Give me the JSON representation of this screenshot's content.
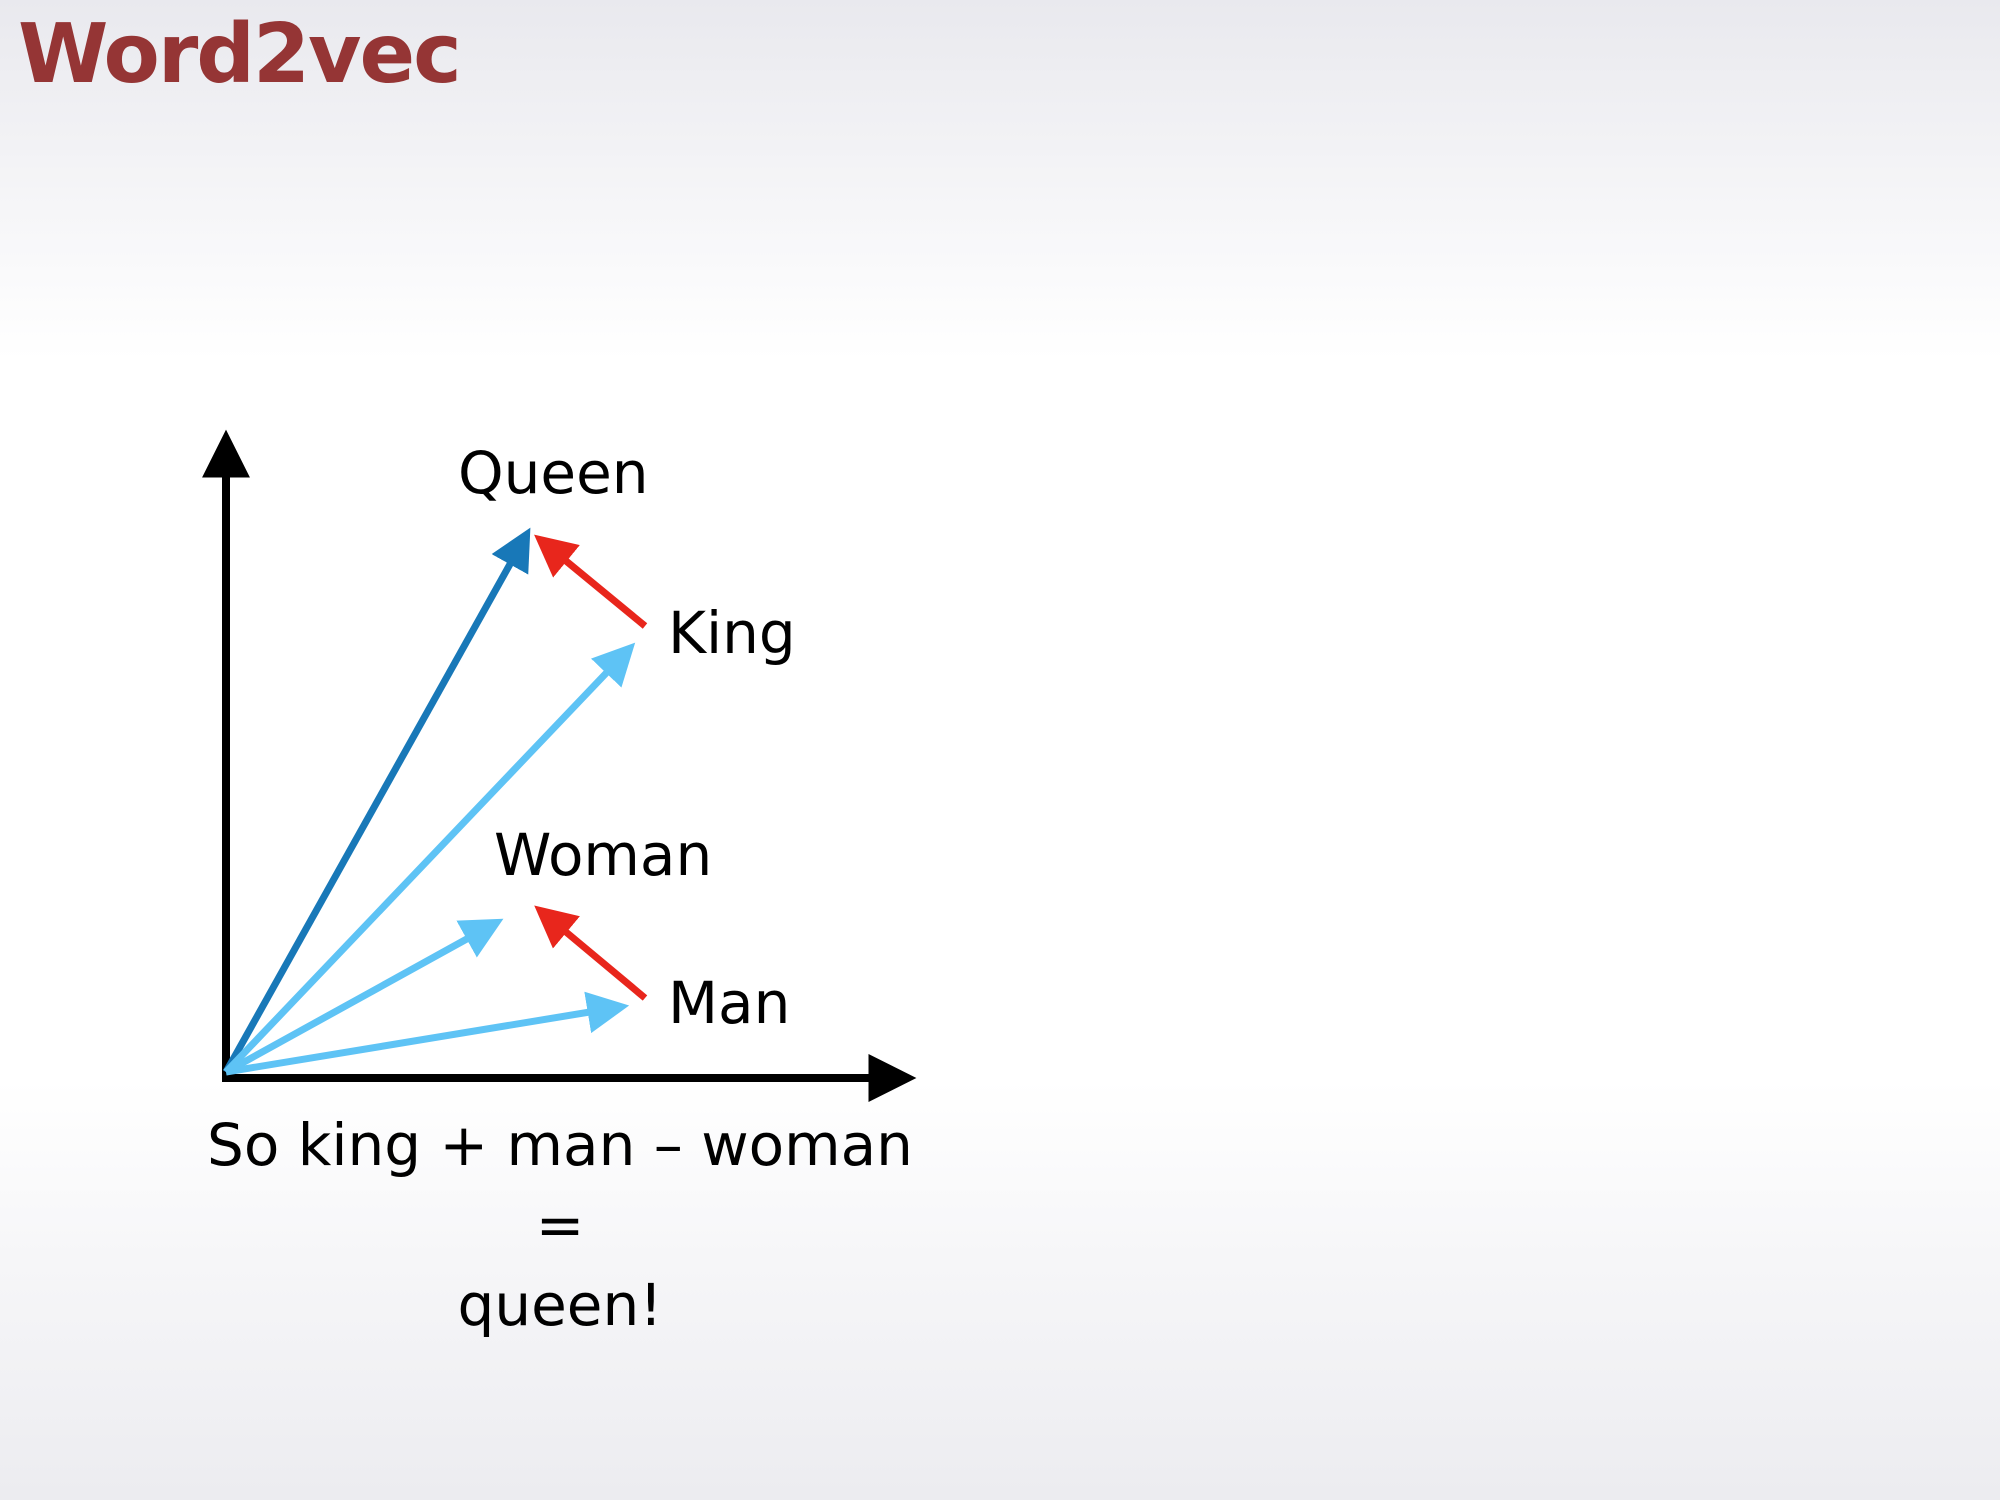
{
  "slide": {
    "title": "Word2vec",
    "caption_line1": "So king + man – woman =",
    "caption_line2": "queen!"
  },
  "diagram": {
    "labels": {
      "queen": "Queen",
      "king": "King",
      "woman": "Woman",
      "man": "Man"
    },
    "colors": {
      "axis": "#000000",
      "queen_vector": "#1878b8",
      "word_vector": "#5ec3f5",
      "difference_vector": "#e8261c",
      "title": "#953535"
    }
  }
}
